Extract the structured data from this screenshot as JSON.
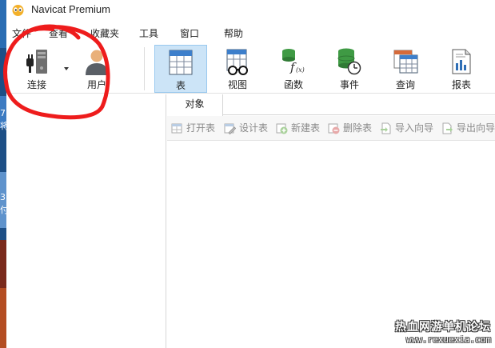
{
  "window": {
    "title": "Navicat Premium"
  },
  "desktop_strip": {
    "glyphs": [
      "7",
      "将",
      "3",
      "付"
    ]
  },
  "menu": {
    "items": [
      "文件",
      "查看",
      "收藏夹",
      "工具",
      "窗口",
      "帮助"
    ]
  },
  "toolbar": {
    "connection_label": "连接",
    "user_label": "用户",
    "table_label": "表",
    "view_label": "视图",
    "function_label": "函数",
    "event_label": "事件",
    "query_label": "查询",
    "report_label": "报表",
    "active_item": "表"
  },
  "object_pane": {
    "tab_label": "对象",
    "actions": {
      "open_table": "打开表",
      "design_table": "设计表",
      "new_table": "新建表",
      "delete_table": "删除表",
      "import_wizard": "导入向导",
      "export_wizard": "导出向导"
    }
  },
  "watermark": {
    "site_name": "热血网游单机论坛",
    "domain": "www.rexuexia.com"
  },
  "colors": {
    "active_button_bg": "#cce4f7",
    "annotation_red": "#ee1c1c",
    "disabled_text": "#8a8a8a"
  }
}
